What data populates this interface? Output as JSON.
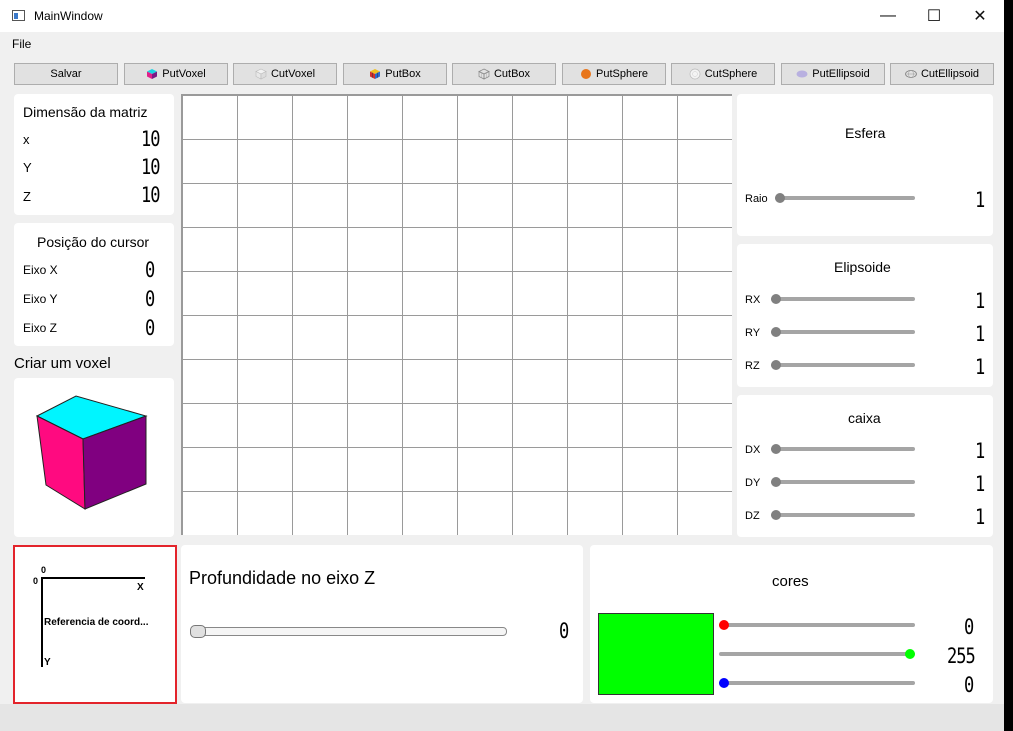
{
  "window": {
    "title": "MainWindow",
    "minimize_glyph": "—",
    "maximize_glyph": "☐",
    "close_glyph": "✕"
  },
  "menu": {
    "file": "File"
  },
  "toolbar": {
    "salvar": "Salvar",
    "put_voxel": "PutVoxel",
    "cut_voxel": "CutVoxel",
    "put_box": "PutBox",
    "cut_box": "CutBox",
    "put_sphere": "PutSphere",
    "cut_sphere": "CutSphere",
    "put_ellipsoid": "PutEllipsoid",
    "cut_ellipsoid": "CutEllipsoid"
  },
  "dimensao": {
    "title": "Dimensão da matriz",
    "x_label": "x",
    "y_label": "Y",
    "z_label": "Z",
    "x_value": "10",
    "y_value": "10",
    "z_value": "10"
  },
  "posicao": {
    "title": "Posição do cursor",
    "x_label": "Eixo X",
    "y_label": "Eixo Y",
    "z_label": "Eixo Z",
    "x_value": "0",
    "y_value": "0",
    "z_value": "0"
  },
  "criar": {
    "title": "Criar um voxel"
  },
  "cube_colors": {
    "top": "#00f5ff",
    "left": "#ff0a80",
    "right": "#800080"
  },
  "esfera": {
    "title": "Esfera",
    "raio_label": "Raio",
    "raio_value": "1"
  },
  "elipsoide": {
    "title": "Elipsoide",
    "rx_label": "RX",
    "ry_label": "RY",
    "rz_label": "RZ",
    "rx_value": "1",
    "ry_value": "1",
    "rz_value": "1"
  },
  "caixa": {
    "title": "caixa",
    "dx_label": "DX",
    "dy_label": "DY",
    "dz_label": "DZ",
    "dx_value": "1",
    "dy_value": "1",
    "dz_value": "1"
  },
  "referencia": {
    "origin": "0",
    "top_zero": "0",
    "x_axis": "X",
    "y_axis": "Y",
    "caption": "Referencia de coord..."
  },
  "profundidade": {
    "title": "Profundidade no eixo Z",
    "value": "0"
  },
  "cores": {
    "title": "cores",
    "r": "0",
    "g": "255",
    "b": "0",
    "swatch": "#00ff00",
    "red_knob": "#ff0000",
    "green_knob": "#00ff00",
    "blue_knob": "#0000ff"
  }
}
